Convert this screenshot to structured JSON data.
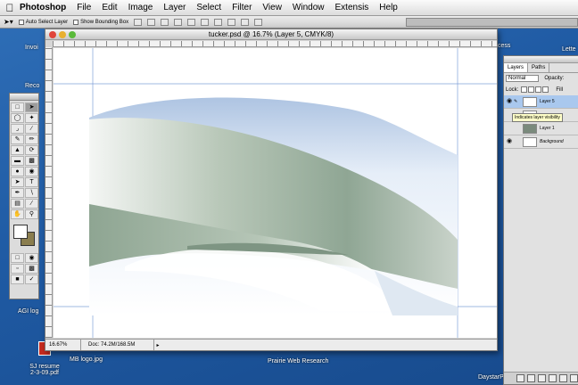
{
  "menubar": {
    "app_name": "Photoshop",
    "items": [
      "File",
      "Edit",
      "Image",
      "Layer",
      "Select",
      "Filter",
      "View",
      "Window",
      "Extensis",
      "Help"
    ]
  },
  "options_bar": {
    "auto_select_label": "Auto Select Layer",
    "bounding_box_label": "Show Bounding Box"
  },
  "desktop": {
    "icons": [
      {
        "label": "Invoi"
      },
      {
        "label": "Reco"
      },
      {
        "label": "AGI log"
      },
      {
        "label": "SJ resume\n2-3-09.pdf"
      },
      {
        "label": "MB logo.jpg"
      },
      {
        "label": "Prairie Web Research"
      },
      {
        "label": "Lette"
      },
      {
        "label": "cess"
      },
      {
        "label": "DaystarPassportDir"
      }
    ]
  },
  "document": {
    "title": "tucker.psd @ 16.7% (Layer 5, CMYK/8)",
    "zoom": "16.67%",
    "doc_info": "Doc: 74.2M/168.5M"
  },
  "layers_panel": {
    "tabs": [
      "Layers",
      "Paths"
    ],
    "blend_mode": "Normal",
    "opacity_label": "Opacity:",
    "lock_label": "Lock:",
    "fill_label": "Fill",
    "layers": [
      {
        "name": "Layer 5",
        "selected": true
      },
      {
        "name": "",
        "selected": false
      },
      {
        "name": "Layer 1",
        "selected": false
      },
      {
        "name": "Background",
        "selected": false
      }
    ],
    "tooltip": "Indicates layer visibility"
  },
  "colors": {
    "desktop": "#1f5aa3",
    "sage": "#8fa694",
    "sky": "#b8cce4",
    "selection": "#a9c8ee"
  }
}
